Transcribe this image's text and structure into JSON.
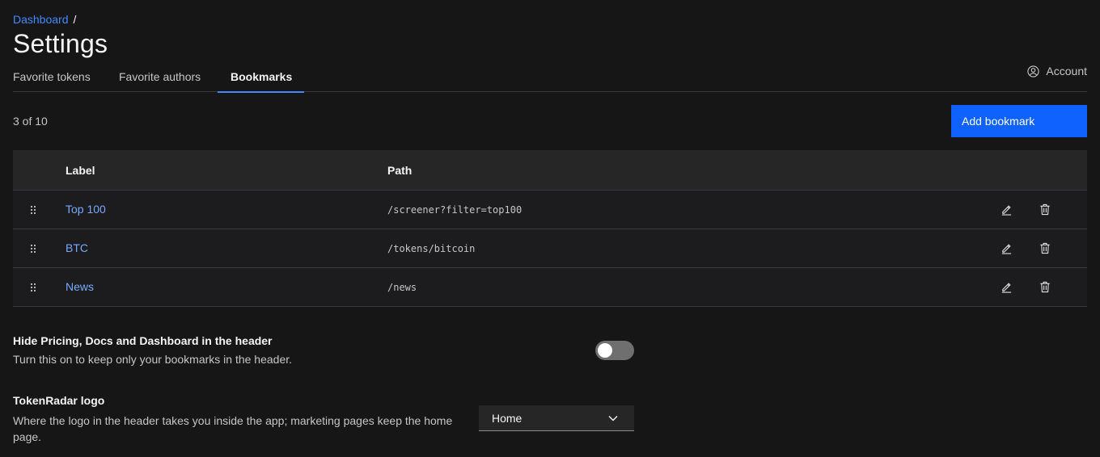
{
  "breadcrumb": {
    "root": "Dashboard",
    "separator": "/"
  },
  "page_title": "Settings",
  "tabs": [
    {
      "label": "Favorite tokens",
      "active": false
    },
    {
      "label": "Favorite authors",
      "active": false
    },
    {
      "label": "Bookmarks",
      "active": true
    }
  ],
  "account": {
    "label": "Account",
    "icon": "user-avatar-icon"
  },
  "bookmarks": {
    "count_text": "3 of 10",
    "add_button_label": "Add bookmark",
    "columns": {
      "label": "Label",
      "path": "Path"
    },
    "rows": [
      {
        "label": "Top 100",
        "path": "/screener?filter=top100"
      },
      {
        "label": "BTC",
        "path": "/tokens/bitcoin"
      },
      {
        "label": "News",
        "path": "/news"
      }
    ]
  },
  "settings": {
    "hide_header": {
      "title": "Hide Pricing, Docs and Dashboard in the header",
      "description": "Turn this on to keep only your bookmarks in the header.",
      "enabled": false
    },
    "logo": {
      "title": "TokenRadar logo",
      "description": "Where the logo in the header takes you inside the app; marketing pages keep the home page.",
      "selected": "Home"
    }
  },
  "colors": {
    "background": "#161616",
    "link": "#78a9ff",
    "accent": "#0f62fe"
  }
}
